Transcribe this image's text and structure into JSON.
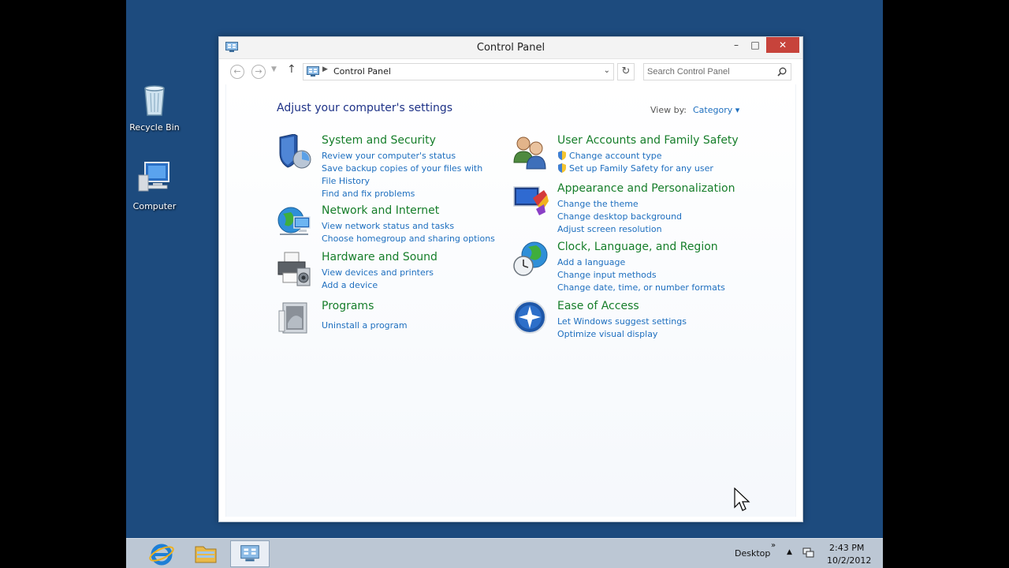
{
  "desktop": {
    "icons": [
      {
        "label": "Recycle Bin",
        "icon": "recycle-bin-icon"
      },
      {
        "label": "Computer",
        "icon": "computer-icon"
      }
    ]
  },
  "window": {
    "title": "Control Panel",
    "controls": {
      "minimize": "–",
      "maximize": "□",
      "close": "✕"
    }
  },
  "navbar": {
    "address": "Control Panel",
    "search_placeholder": "Search Control Panel"
  },
  "content": {
    "heading": "Adjust your computer's settings",
    "view_by_label": "View by:",
    "view_by_value": "Category ▾",
    "categories": [
      {
        "title": "System and Security",
        "icon": "shield-icon",
        "links": [
          "Review your computer's status",
          "Save backup copies of your files with File History",
          "Find and fix problems"
        ]
      },
      {
        "title": "Network and Internet",
        "icon": "globe-network-icon",
        "links": [
          "View network status and tasks",
          "Choose homegroup and sharing options"
        ]
      },
      {
        "title": "Hardware and Sound",
        "icon": "printer-speaker-icon",
        "links": [
          "View devices and printers",
          "Add a device"
        ]
      },
      {
        "title": "Programs",
        "icon": "programs-icon",
        "links": [
          "Uninstall a program"
        ]
      },
      {
        "title": "User Accounts and Family Safety",
        "icon": "users-icon",
        "links": [
          "Change account type",
          "Set up Family Safety for any user"
        ]
      },
      {
        "title": "Appearance and Personalization",
        "icon": "monitor-paint-icon",
        "links": [
          "Change the theme",
          "Change desktop background",
          "Adjust screen resolution"
        ]
      },
      {
        "title": "Clock, Language, and Region",
        "icon": "clock-globe-icon",
        "links": [
          "Add a language",
          "Change input methods",
          "Change date, time, or number formats"
        ]
      },
      {
        "title": "Ease of Access",
        "icon": "ease-of-access-icon",
        "links": [
          "Let Windows suggest settings",
          "Optimize visual display"
        ]
      }
    ]
  },
  "taskbar": {
    "desktop_label": "Desktop",
    "time": "2:43 PM",
    "date": "10/2/2012"
  },
  "colors": {
    "desktop_bg": "#1d4b7e",
    "link": "#1e6fbf",
    "category_title": "#167e2a",
    "heading": "#1e3287",
    "close_button": "#c7433b"
  }
}
